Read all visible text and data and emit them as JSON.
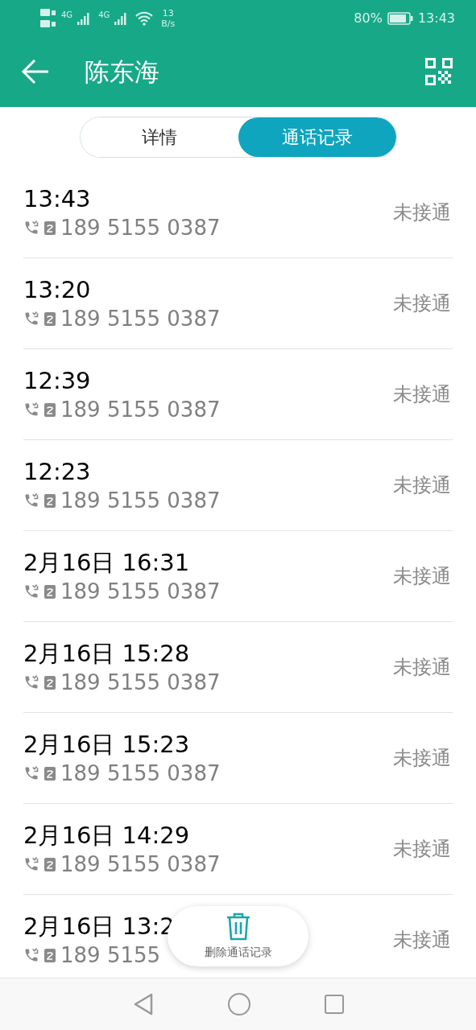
{
  "status_bar": {
    "networks": [
      "4G",
      "4G"
    ],
    "speed_value": "13",
    "speed_unit": "B/s",
    "battery": "80%",
    "time": "13:43"
  },
  "header": {
    "title": "陈东海"
  },
  "tabs": [
    {
      "label": "详情",
      "selected": false
    },
    {
      "label": "通话记录",
      "selected": true
    }
  ],
  "calls": [
    {
      "time": "13:43",
      "number": "189 5155 0387",
      "status": "未接通"
    },
    {
      "time": "13:20",
      "number": "189 5155 0387",
      "status": "未接通"
    },
    {
      "time": "12:39",
      "number": "189 5155 0387",
      "status": "未接通"
    },
    {
      "time": "12:23",
      "number": "189 5155 0387",
      "status": "未接通"
    },
    {
      "time": "2月16日 16:31",
      "number": "189 5155 0387",
      "status": "未接通"
    },
    {
      "time": "2月16日 15:28",
      "number": "189 5155 0387",
      "status": "未接通"
    },
    {
      "time": "2月16日 15:23",
      "number": "189 5155 0387",
      "status": "未接通"
    },
    {
      "time": "2月16日 14:29",
      "number": "189 5155 0387",
      "status": "未接通"
    },
    {
      "time": "2月16日 13:2",
      "number": "189 5155",
      "status": "未接通"
    }
  ],
  "delete_button": {
    "label": "删除通话记录"
  }
}
